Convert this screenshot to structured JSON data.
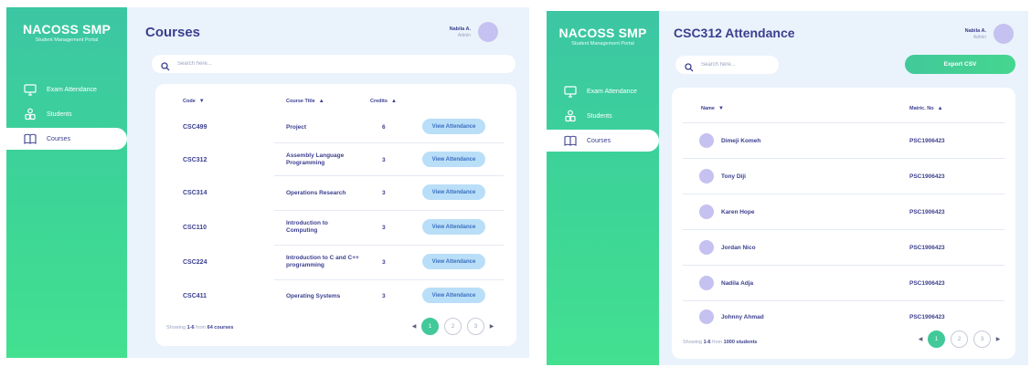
{
  "colors": {
    "accent_green": "#42c99a",
    "navy": "#3b3f8f",
    "button_blue_bg": "#b9def8",
    "button_blue_text": "#3b6fc0",
    "avatar_purple": "#c5c1f0",
    "panel_bg": "#eaf3fb"
  },
  "left": {
    "brand": {
      "title": "NACOSS SMP",
      "subtitle": "Student Management Portal"
    },
    "nav": [
      {
        "label": "Exam Attendance",
        "icon": "monitor-check-icon"
      },
      {
        "label": "Students",
        "icon": "users-icon"
      },
      {
        "label": "Courses",
        "icon": "book-open-icon",
        "active": true
      }
    ],
    "page_title": "Courses",
    "user": {
      "name": "Nabila A.",
      "role": "Admin"
    },
    "search": {
      "placeholder": "Search here..."
    },
    "table": {
      "headers": {
        "code": "Code",
        "title": "Course Title",
        "credits": "Credits"
      },
      "rows": [
        {
          "code": "CSC499",
          "title": "Project",
          "credits": "6",
          "action": "View Attendance"
        },
        {
          "code": "CSC312",
          "title": "Assembly Language Programming",
          "credits": "3",
          "action": "View Attendance"
        },
        {
          "code": "CSC314",
          "title": "Operations Research",
          "credits": "3",
          "action": "View Attendance"
        },
        {
          "code": "CSC110",
          "title": "Introduction to Computing",
          "credits": "3",
          "action": "View Attendance"
        },
        {
          "code": "CSC224",
          "title": "Introduction to C and C++ programming",
          "credits": "3",
          "action": "View Attendance"
        },
        {
          "code": "CSC411",
          "title": "Operating Systems",
          "credits": "3",
          "action": "View Attendance"
        }
      ]
    },
    "footer": {
      "prefix": "Showing ",
      "range": "1-6",
      "mid": " from ",
      "total": "64 courses"
    },
    "pagination": [
      "1",
      "2",
      "3"
    ]
  },
  "right": {
    "brand": {
      "title": "NACOSS SMP",
      "subtitle": "Student Management Portal"
    },
    "nav": [
      {
        "label": "Exam Attendance",
        "icon": "monitor-check-icon"
      },
      {
        "label": "Students",
        "icon": "users-icon"
      },
      {
        "label": "Courses",
        "icon": "book-open-icon",
        "active": true
      }
    ],
    "page_title": "CSC312 Attendance",
    "user": {
      "name": "Nabila A.",
      "role": "Admin"
    },
    "search": {
      "placeholder": "Search here..."
    },
    "export_label": "Export CSV",
    "table": {
      "headers": {
        "name": "Name",
        "matric": "Matric. No"
      },
      "rows": [
        {
          "name": "Dimeji Komeh",
          "matric": "PSC1906423"
        },
        {
          "name": "Tony Diji",
          "matric": "PSC1906423"
        },
        {
          "name": "Karen Hope",
          "matric": "PSC1906423"
        },
        {
          "name": "Jordan Nico",
          "matric": "PSC1906423"
        },
        {
          "name": "Nadila Adja",
          "matric": "PSC1906423"
        },
        {
          "name": "Johnny Ahmad",
          "matric": "PSC1906423"
        }
      ]
    },
    "footer": {
      "prefix": "Showing ",
      "range": "1-6",
      "mid": " from ",
      "total": "1000 students"
    },
    "pagination": [
      "1",
      "2",
      "3"
    ]
  }
}
